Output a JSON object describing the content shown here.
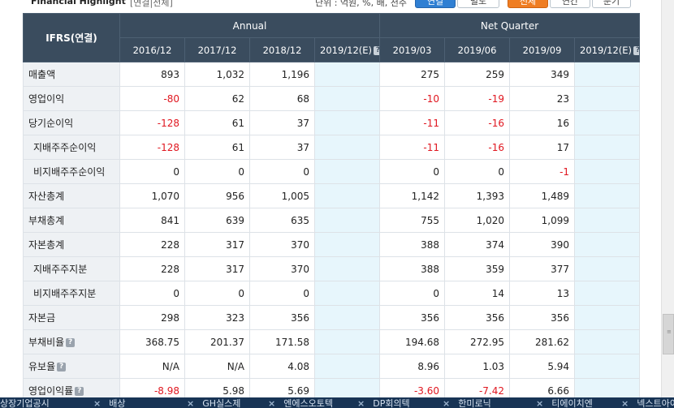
{
  "header": {
    "title": "Financial Highlight",
    "subtitle": "[연결|전체]",
    "unit_note": "단위 : 억원, %, 배, 천주",
    "buttons": [
      "연결",
      "별도",
      "전체",
      "연간",
      "분기"
    ]
  },
  "table": {
    "corner_label": "IFRS(연결)",
    "groups": {
      "annual": "Annual",
      "quarter": "Net Quarter"
    },
    "annual_cols": [
      "2016/12",
      "2017/12",
      "2018/12",
      "2019/12(E)"
    ],
    "quarter_cols": [
      "2019/03",
      "2019/06",
      "2019/09",
      "2019/12(E)"
    ],
    "rows": [
      {
        "label": "매출액",
        "indent": false,
        "help": false,
        "annual": [
          "893",
          "1,032",
          "1,196",
          ""
        ],
        "quarter": [
          "275",
          "259",
          "349",
          ""
        ]
      },
      {
        "label": "영업이익",
        "indent": false,
        "help": false,
        "annual": [
          "-80",
          "62",
          "68",
          ""
        ],
        "quarter": [
          "-10",
          "-19",
          "23",
          ""
        ]
      },
      {
        "label": "당기순이익",
        "indent": false,
        "help": false,
        "annual": [
          "-128",
          "61",
          "37",
          ""
        ],
        "quarter": [
          "-11",
          "-16",
          "16",
          ""
        ]
      },
      {
        "label": "지배주주순이익",
        "indent": true,
        "help": false,
        "annual": [
          "-128",
          "61",
          "37",
          ""
        ],
        "quarter": [
          "-11",
          "-16",
          "17",
          ""
        ]
      },
      {
        "label": "비지배주주순이익",
        "indent": true,
        "help": false,
        "annual": [
          "0",
          "0",
          "0",
          ""
        ],
        "quarter": [
          "0",
          "0",
          "-1",
          ""
        ]
      },
      {
        "label": "자산총계",
        "indent": false,
        "help": false,
        "annual": [
          "1,070",
          "956",
          "1,005",
          ""
        ],
        "quarter": [
          "1,142",
          "1,393",
          "1,489",
          ""
        ]
      },
      {
        "label": "부채총계",
        "indent": false,
        "help": false,
        "annual": [
          "841",
          "639",
          "635",
          ""
        ],
        "quarter": [
          "755",
          "1,020",
          "1,099",
          ""
        ]
      },
      {
        "label": "자본총계",
        "indent": false,
        "help": false,
        "annual": [
          "228",
          "317",
          "370",
          ""
        ],
        "quarter": [
          "388",
          "374",
          "390",
          ""
        ]
      },
      {
        "label": "지배주주지분",
        "indent": true,
        "help": false,
        "annual": [
          "228",
          "317",
          "370",
          ""
        ],
        "quarter": [
          "388",
          "359",
          "377",
          ""
        ]
      },
      {
        "label": "비지배주주지분",
        "indent": true,
        "help": false,
        "annual": [
          "0",
          "0",
          "0",
          ""
        ],
        "quarter": [
          "0",
          "14",
          "13",
          ""
        ]
      },
      {
        "label": "자본금",
        "indent": false,
        "help": false,
        "annual": [
          "298",
          "323",
          "356",
          ""
        ],
        "quarter": [
          "356",
          "356",
          "356",
          ""
        ]
      },
      {
        "label": "부채비율",
        "indent": false,
        "help": true,
        "annual": [
          "368.75",
          "201.37",
          "171.58",
          ""
        ],
        "quarter": [
          "194.68",
          "272.95",
          "281.62",
          ""
        ]
      },
      {
        "label": "유보율",
        "indent": false,
        "help": true,
        "annual": [
          "N/A",
          "N/A",
          "4.08",
          ""
        ],
        "quarter": [
          "8.96",
          "1.03",
          "5.94",
          ""
        ]
      },
      {
        "label": "영업이익률",
        "indent": false,
        "help": true,
        "annual": [
          "-8.98",
          "5.98",
          "5.69",
          ""
        ],
        "quarter": [
          "-3.60",
          "-7.42",
          "6.66",
          ""
        ]
      }
    ]
  },
  "bottom_bar": {
    "items": [
      "상장기업공시",
      "배상",
      "GH실스제",
      "엔에스오토텍",
      "DP회의텍",
      "한미로닉",
      "티에이치엔",
      "넥스트아이"
    ]
  },
  "colors": {
    "negative": "#e0161f",
    "header_bg": "#3a4c5e",
    "estimate_bg": "#e7f6fc"
  }
}
